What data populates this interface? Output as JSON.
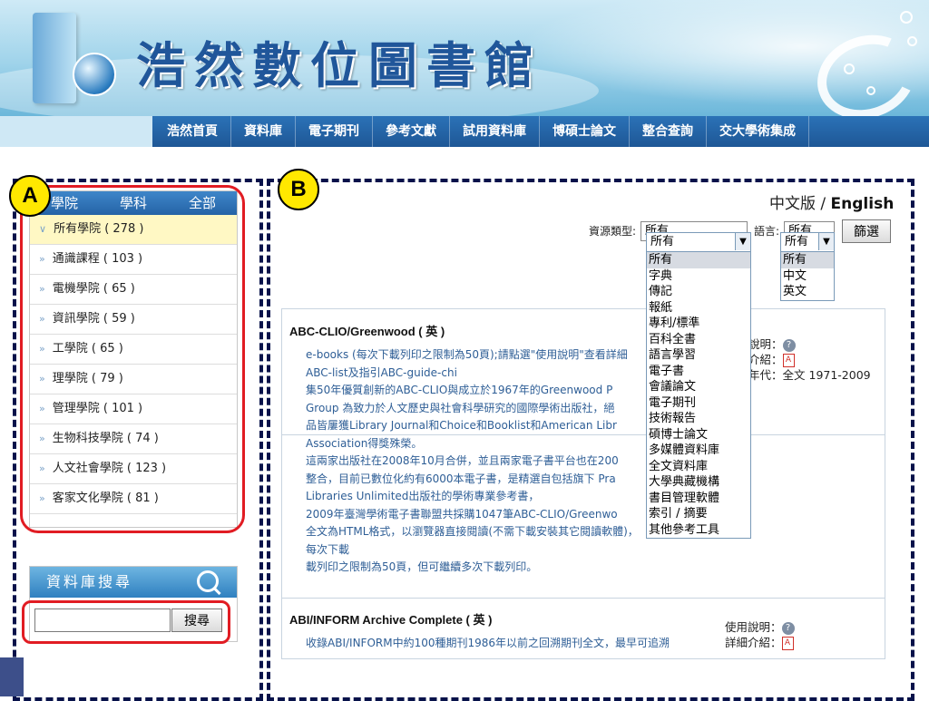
{
  "banner": {
    "title": "浩然數位圖書館"
  },
  "nav": {
    "items": [
      "浩然首頁",
      "資料庫",
      "電子期刊",
      "參考文獻",
      "試用資料庫",
      "博碩士論文",
      "整合查詢",
      "交大學術集成"
    ]
  },
  "annotations": {
    "a": "A",
    "b": "B"
  },
  "sidebar": {
    "tabs": [
      "學院",
      "學科",
      "全部"
    ],
    "items": [
      {
        "label": "所有學院 ( 278 )",
        "selected": true
      },
      {
        "label": "通識課程 ( 103 )"
      },
      {
        "label": "電機學院 ( 65 )"
      },
      {
        "label": "資訊學院 ( 59 )"
      },
      {
        "label": "工學院 ( 65 )"
      },
      {
        "label": "理學院 ( 79 )"
      },
      {
        "label": "管理學院 ( 101 )"
      },
      {
        "label": "生物科技學院 ( 74 )"
      },
      {
        "label": "人文社會學院 ( 123 )"
      },
      {
        "label": "客家文化學院 ( 81 )"
      }
    ]
  },
  "search": {
    "title": "資料庫搜尋",
    "value": "",
    "button": "搜尋"
  },
  "lang_switch": {
    "zh": "中文版",
    "sep": " / ",
    "en": "English"
  },
  "filters": {
    "type_label": "資源類型:",
    "type_value": "所有",
    "type_options": [
      "所有",
      "字典",
      "傳記",
      "報紙",
      "專利/標準",
      "百科全書",
      "語言學習",
      "電子書",
      "會議論文",
      "電子期刊",
      "技術報告",
      "碩博士論文",
      "多媒體資料庫",
      "全文資料庫",
      "大學典藏機構",
      "書目管理軟體",
      "索引 / 摘要",
      "其他參考工具"
    ],
    "lang_label": "語言:",
    "lang_value": "所有",
    "lang_options": [
      "所有",
      "中文",
      "英文"
    ],
    "filter_button": "篩選"
  },
  "results": [
    {
      "title": "ABC-CLIO/Greenwood ( 英 )",
      "lines": [
        "e-books (每次下載列印之限制為50頁);請點選\"使用說明\"查看詳細",
        "ABC-list及指引ABC-guide-chi",
        "集50年優質創新的ABC-CLIO與成立於1967年的Greenwood P",
        "Group 為致力於人文歷史與社會科學研究的國際學術出版社，絕",
        "品皆屢獲Library Journal和Choice和Booklist和American Libr",
        "Association得獎殊榮。",
        "這兩家出版社在2008年10月合併，並且兩家電子書平台也在200",
        "整合，目前已數位化約有6000本電子書，是精選自包括旗下 Pra",
        "Libraries Unlimited出版社的學術專業參考書，",
        "2009年臺灣學術電子書聯盟共採購1047筆ABC-CLIO/Greenwo",
        "全文為HTML格式，以瀏覽器直接閱讀(不需下載安裝其它閱讀軟體)，每次下載",
        "載列印之限制為50頁，但可繼續多次下載列印。"
      ],
      "usage_label": "說明：",
      "detail_label": "介紹：",
      "years_label": "年代：",
      "years": "全文 1971-2009"
    },
    {
      "title": "ABI/INFORM Archive Complete ( 英 )",
      "lines": [
        "收錄ABI/INFORM中約100種期刊1986年以前之回溯期刊全文，最早可追溯"
      ],
      "usage_label": "使用說明：",
      "detail_label": "詳細介紹："
    }
  ]
}
